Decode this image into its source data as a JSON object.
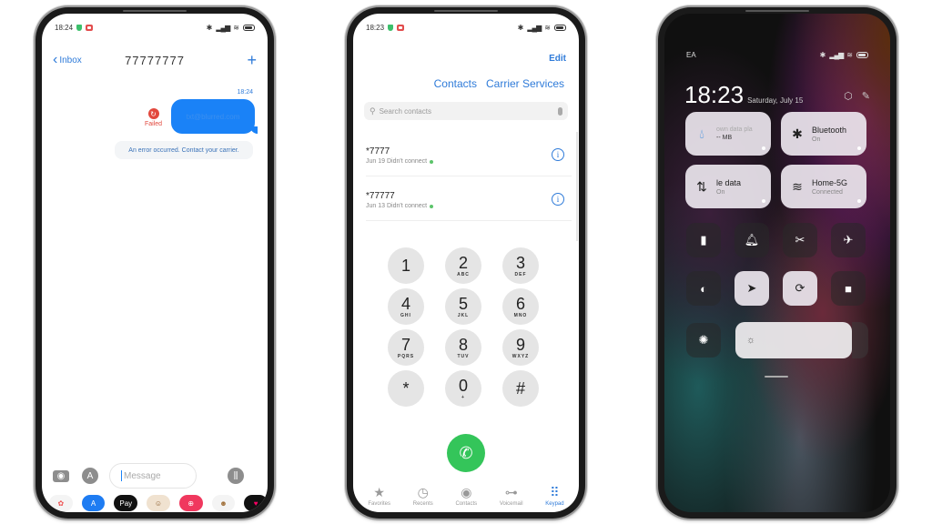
{
  "messages_phone": {
    "status": {
      "time": "18:24"
    },
    "nav": {
      "back_label": "Inbox",
      "title": "77777777",
      "add_icon": "+"
    },
    "timestamp": "18:24",
    "bubble_text": "txt@blurred.com",
    "failed_label": "Failed",
    "error_text": "An error occurred. Contact your carrier.",
    "composer": {
      "placeholder": "Message"
    },
    "app_drawer": [
      "photos",
      "app-store",
      "apple-pay",
      "memoji",
      "image-search",
      "animoji",
      "digital-touch"
    ],
    "apple_pay_label": "Pay"
  },
  "dialer_phone": {
    "status": {
      "time": "18:23"
    },
    "edit_label": "Edit",
    "tabs": [
      "Contacts",
      "Carrier Services"
    ],
    "search_placeholder": "Search contacts",
    "calls": [
      {
        "number": "*7777",
        "meta": "Jun 19 Didn't connect"
      },
      {
        "number": "*77777",
        "meta": "Jun 13 Didn't connect"
      }
    ],
    "keypad": [
      {
        "digit": "1",
        "letters": ""
      },
      {
        "digit": "2",
        "letters": "ABC"
      },
      {
        "digit": "3",
        "letters": "DEF"
      },
      {
        "digit": "4",
        "letters": "GHI"
      },
      {
        "digit": "5",
        "letters": "JKL"
      },
      {
        "digit": "6",
        "letters": "MNO"
      },
      {
        "digit": "7",
        "letters": "PQRS"
      },
      {
        "digit": "8",
        "letters": "TUV"
      },
      {
        "digit": "9",
        "letters": "WXYZ"
      },
      {
        "digit": "*",
        "letters": ""
      },
      {
        "digit": "0",
        "letters": "+"
      },
      {
        "digit": "#",
        "letters": ""
      }
    ],
    "tabbar": [
      {
        "label": "Favorites",
        "icon": "★"
      },
      {
        "label": "Recents",
        "icon": "◷"
      },
      {
        "label": "Contacts",
        "icon": "◉"
      },
      {
        "label": "Voicemail",
        "icon": "⊶"
      },
      {
        "label": "Keypad",
        "icon": "⠿",
        "active": true
      }
    ]
  },
  "control_phone": {
    "status": {
      "carrier": "EA"
    },
    "time": "18:23",
    "date": "Saturday, July 15",
    "tiles": {
      "data_usage": {
        "title": "own data pla",
        "sub": "-- MB"
      },
      "bluetooth": {
        "title": "Bluetooth",
        "sub": "On"
      },
      "mobile_data": {
        "title": "le data",
        "sub": "On"
      },
      "wifi": {
        "title": "Home-5G",
        "sub": "Connected"
      }
    },
    "toggles": [
      {
        "name": "flashlight",
        "on": false
      },
      {
        "name": "silent",
        "on": false
      },
      {
        "name": "screenshot",
        "on": false
      },
      {
        "name": "airplane",
        "on": false
      },
      {
        "name": "dark-mode",
        "on": false
      },
      {
        "name": "location",
        "on": true
      },
      {
        "name": "rotation-lock",
        "on": true
      },
      {
        "name": "screen-record",
        "on": false
      },
      {
        "name": "auto-brightness",
        "on": false
      }
    ],
    "brightness_level": 0.85
  },
  "colors": {
    "accent": "#2f7bd9",
    "bubble": "#1a82f7",
    "error": "#e2483d",
    "call": "#34c55a"
  }
}
